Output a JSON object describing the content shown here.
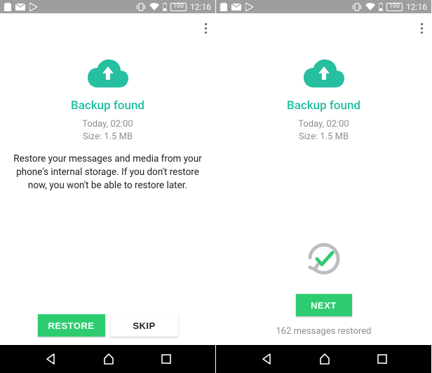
{
  "status": {
    "battery": "100",
    "clock": "12:16"
  },
  "left": {
    "title": "Backup found",
    "line1": "Today, 02:00",
    "line2": "Size: 1.5 MB",
    "desc": "Restore your messages and media from your phone's internal storage. If you don't restore now, you won't be able to restore later.",
    "restore": "Restore",
    "skip": "Skip"
  },
  "right": {
    "title": "Backup found",
    "line1": "Today, 02:00",
    "line2": "Size: 1.5 MB",
    "next": "Next",
    "restored": "162 messages restored"
  }
}
